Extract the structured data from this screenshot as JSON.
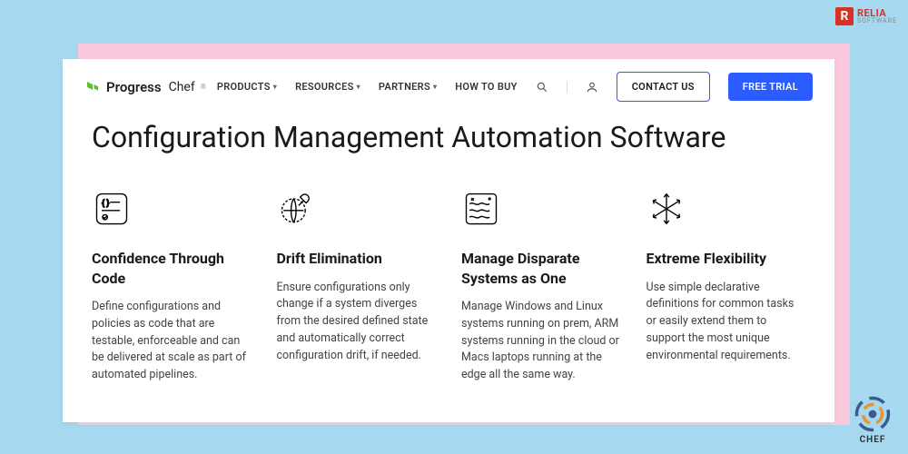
{
  "relia": {
    "top": "RELIA",
    "bottom": "SOFTWARE"
  },
  "logo": {
    "brand": "Progress",
    "product": "Chef"
  },
  "nav": {
    "items": [
      {
        "label": "PRODUCTS",
        "dropdown": true
      },
      {
        "label": "RESOURCES",
        "dropdown": true
      },
      {
        "label": "PARTNERS",
        "dropdown": true
      },
      {
        "label": "HOW TO BUY",
        "dropdown": false
      }
    ],
    "contact": "CONTACT US",
    "trial": "FREE TRIAL"
  },
  "page_title": "Configuration Management Automation Software",
  "features": [
    {
      "title": "Confidence Through Code",
      "desc": "Define configurations and policies as code that are testable, enforceable and can be delivered at scale as part of automated pipelines."
    },
    {
      "title": "Drift Elimination",
      "desc": "Ensure configurations only change if a system diverges from the desired defined state and automatically correct configuration drift, if needed."
    },
    {
      "title": "Manage Disparate Systems as One",
      "desc": "Manage Windows and Linux systems running on prem, ARM systems running in the cloud or Macs laptops running at the edge all the same way."
    },
    {
      "title": "Extreme Flexibility",
      "desc": "Use simple declarative definitions for common tasks or easily extend them to support the most unique environmental requirements."
    }
  ],
  "chef_watermark": "CHEF"
}
